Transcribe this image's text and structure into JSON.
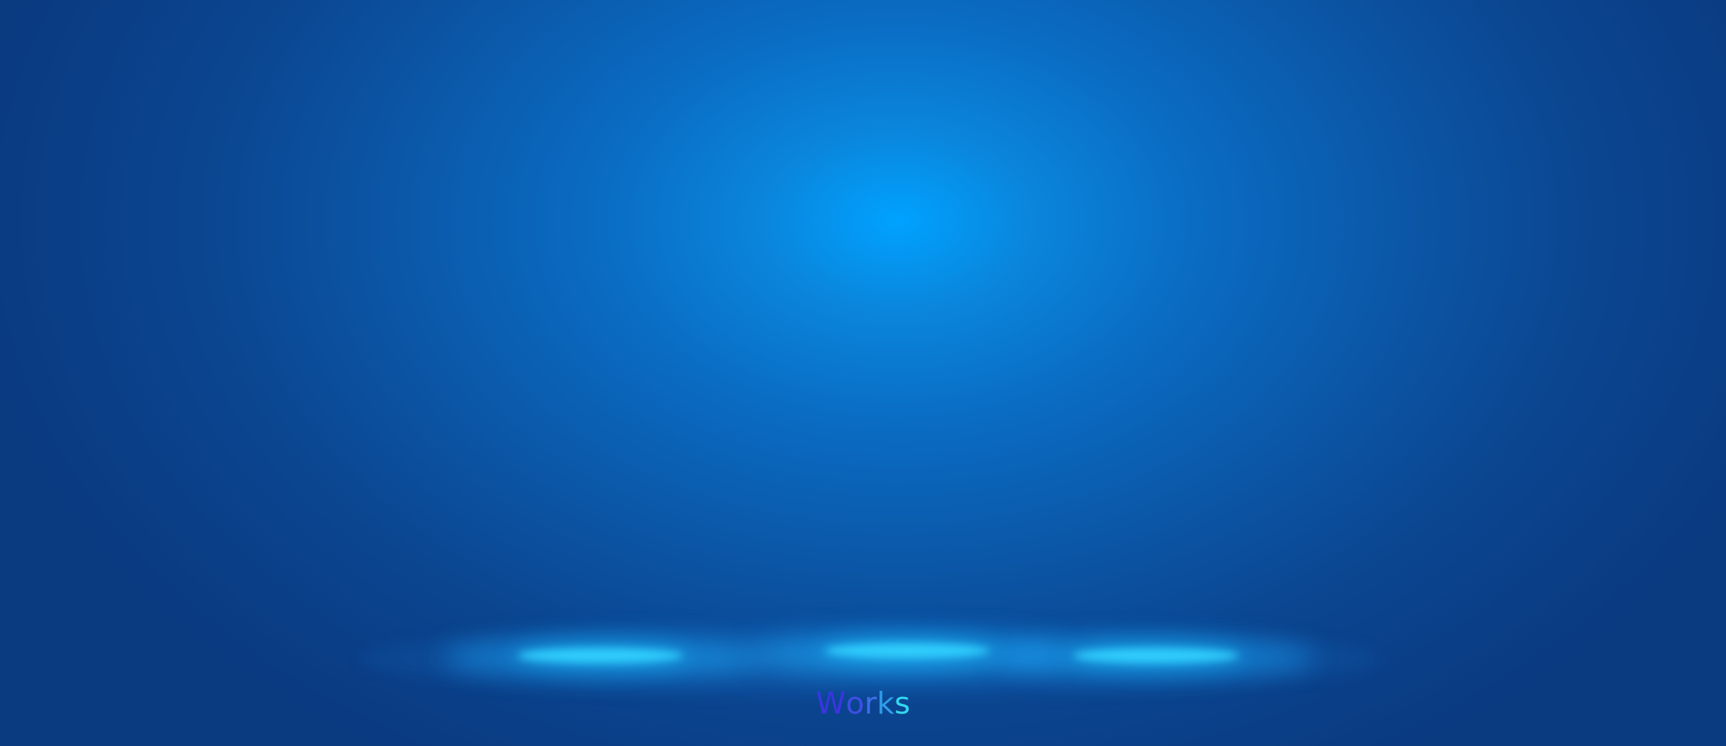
{
  "background": {
    "center_color": "#00a2ff",
    "edge_color": "#0a3a80"
  },
  "spotlights": [
    {
      "name": "left",
      "color": "#19c6ff"
    },
    {
      "name": "center",
      "color": "#19c6ff"
    },
    {
      "name": "right",
      "color": "#19c6ff"
    }
  ],
  "logo": {
    "text": "Works",
    "letters": [
      {
        "char": "W",
        "color": "#3a35e0"
      },
      {
        "char": "o",
        "color": "#3f4ee6"
      },
      {
        "char": "r",
        "color": "#3f6ee8"
      },
      {
        "char": "k",
        "color": "#2e9be8"
      },
      {
        "char": "s",
        "color": "#34d6ef"
      }
    ]
  }
}
